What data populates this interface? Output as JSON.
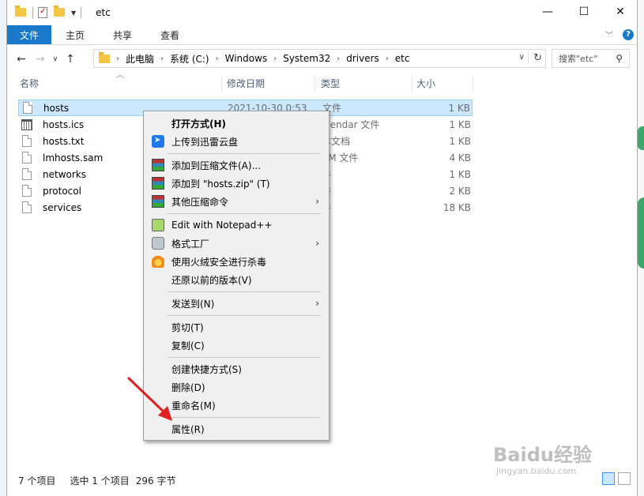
{
  "window": {
    "title": "etc",
    "controls": {
      "minimize": "—",
      "maximize": "☐",
      "close": "✕"
    }
  },
  "ribbon": {
    "tabs": [
      "文件",
      "主页",
      "共享",
      "查看"
    ],
    "help": "?"
  },
  "address": {
    "crumbs": [
      "此电脑",
      "系统 (C:)",
      "Windows",
      "System32",
      "drivers",
      "etc"
    ],
    "search_placeholder": "搜索\"etc\""
  },
  "columns": {
    "name": "名称",
    "date": "修改日期",
    "type": "类型",
    "size": "大小"
  },
  "files": [
    {
      "name": "hosts",
      "date": "2021-10-30 0:53",
      "type": "文件",
      "size": "1 KB",
      "icon": "file-icon",
      "selected": true
    },
    {
      "name": "hosts.ics",
      "date": "",
      "type": "alendar 文件",
      "size": "1 KB",
      "icon": "calendar-file-icon"
    },
    {
      "name": "hosts.txt",
      "date": "",
      "type": "本文档",
      "size": "1 KB",
      "icon": "file-icon"
    },
    {
      "name": "lmhosts.sam",
      "date": "",
      "type": "AM 文件",
      "size": "4 KB",
      "icon": "file-icon"
    },
    {
      "name": "networks",
      "date": "",
      "type": "件",
      "size": "1 KB",
      "icon": "file-icon"
    },
    {
      "name": "protocol",
      "date": "",
      "type": "件",
      "size": "2 KB",
      "icon": "file-icon"
    },
    {
      "name": "services",
      "date": "",
      "type": "件",
      "size": "18 KB",
      "icon": "file-icon"
    }
  ],
  "context_menu": {
    "open_with": "打开方式(H)",
    "upload_xunlei": "上传到迅雷云盘",
    "add_archive": "添加到压缩文件(A)...",
    "add_zip": "添加到 \"hosts.zip\" (T)",
    "other_compress": "其他压缩命令",
    "edit_npp": "Edit with Notepad++",
    "format_factory": "格式工厂",
    "huorong_scan": "使用火绒安全进行杀毒",
    "restore_previous": "还原以前的版本(V)",
    "send_to": "发送到(N)",
    "cut": "剪切(T)",
    "copy": "复制(C)",
    "create_shortcut": "创建快捷方式(S)",
    "delete": "删除(D)",
    "rename": "重命名(M)",
    "properties": "属性(R)"
  },
  "status": {
    "item_count": "7 个项目",
    "selection": "选中 1 个项目",
    "selection_size": "296 字节"
  },
  "watermark": {
    "logo": "Baidu经验",
    "url": "jingyan.baidu.com"
  },
  "colors": {
    "accent": "#1979ca",
    "selection": "#cce8ff",
    "annotation_arrow": "#e02020"
  }
}
